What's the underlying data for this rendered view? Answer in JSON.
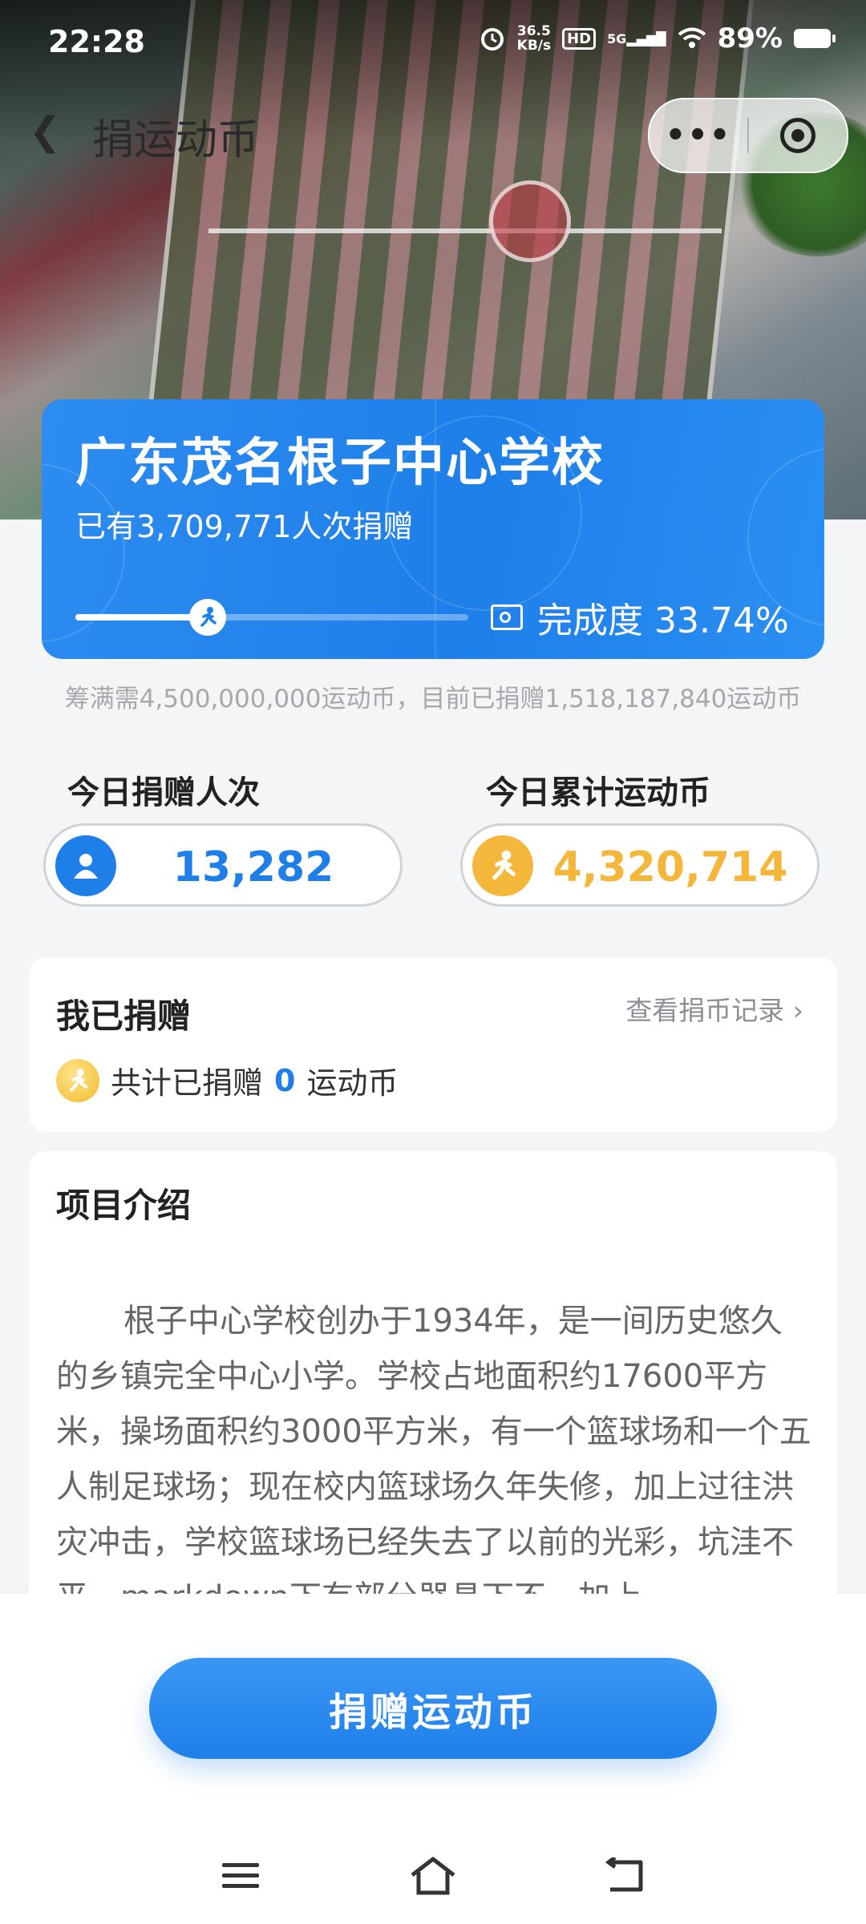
{
  "status_bar": {
    "time": "22:28",
    "net_speed_value": "36.5",
    "net_speed_unit": "KB/s",
    "hd": "HD",
    "network": "5G",
    "battery": "89%"
  },
  "nav": {
    "title": "捐运动币"
  },
  "project": {
    "name": "广东茂名根子中心学校",
    "donors_text": "已有3,709,771人次捐赠",
    "completion_label": "完成度 33.74%",
    "completion_fraction": 0.3374,
    "goal_note": "筹满需4,500,000,000运动币，目前已捐赠1,518,187,840运动币"
  },
  "stats": {
    "donors_today_label": "今日捐赠人次",
    "donors_today_value": "13,282",
    "coins_today_label": "今日累计运动币",
    "coins_today_value": "4,320,714"
  },
  "my_donation": {
    "title": "我已捐赠",
    "record_link": "查看捐币记录",
    "prefix": "共计已捐赠",
    "amount": "0",
    "suffix": "运动币"
  },
  "intro": {
    "title": "项目介绍",
    "text": "根子中心学校创办于1934年，是一间历史悠久的乡镇完全中心小学。学校占地面积约17600平方米，操场面积约3000平方米，有一个篮球场和一个五人制足球场；现在校内篮球场久年失修，加上过往洪灾冲击，学校篮球场已经失去了以前的光彩，坑洼不平，markdown下有部分器具下不，加上"
  },
  "donate_button": "捐赠运动币",
  "colors": {
    "primary_blue": "#1f7fe9",
    "coin_orange": "#f5b73b",
    "page_bg": "#f4f5f7"
  }
}
